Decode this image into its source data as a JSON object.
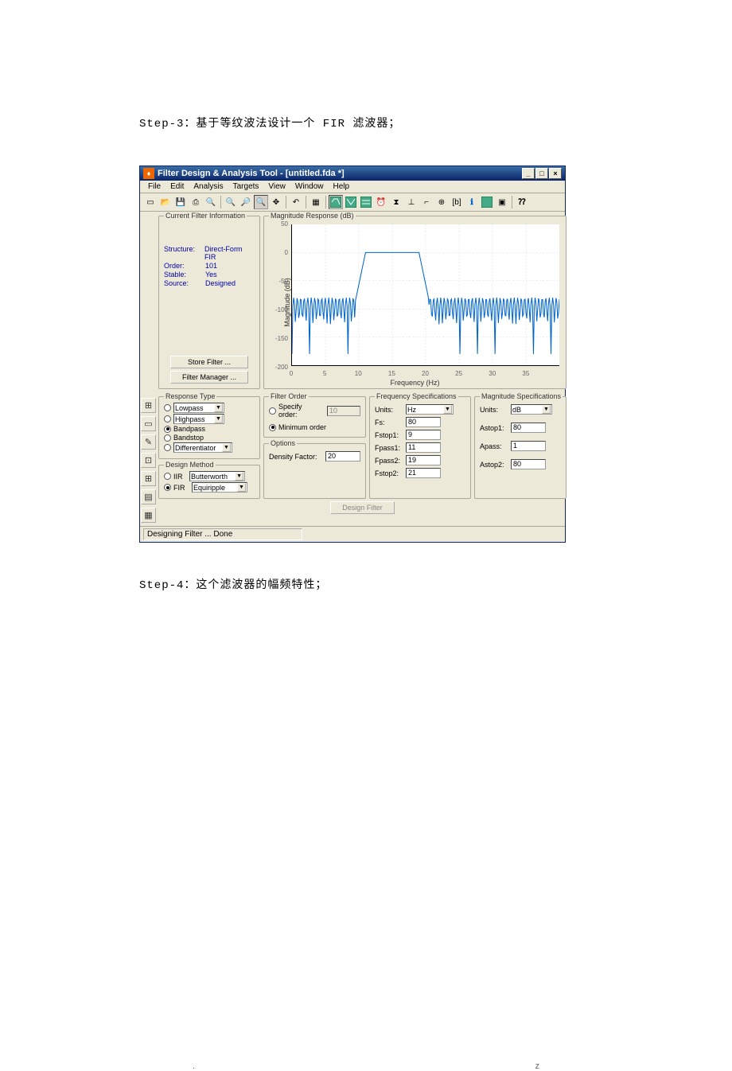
{
  "step3_text": "Step-3：基于等纹波法设计一个 FIR 滤波器；",
  "step4_text": "Step-4：这个滤波器的幅频特性；",
  "footer_left": ".",
  "footer_right": "z",
  "titlebar": "Filter Design & Analysis Tool - [untitled.fda *]",
  "menus": [
    "File",
    "Edit",
    "Analysis",
    "Targets",
    "View",
    "Window",
    "Help"
  ],
  "cfi": {
    "title": "Current Filter Information",
    "structure_k": "Structure:",
    "structure_v": "Direct-Form FIR",
    "order_k": "Order:",
    "order_v": "101",
    "stable_k": "Stable:",
    "stable_v": "Yes",
    "source_k": "Source:",
    "source_v": "Designed",
    "store_btn": "Store Filter ...",
    "manager_btn": "Filter Manager ..."
  },
  "mag": {
    "title": "Magnitude Response (dB)",
    "ylabel": "Magnitude (dB)",
    "xlabel": "Frequency (Hz)"
  },
  "rt": {
    "title": "Response Type",
    "lowpass": "Lowpass",
    "highpass": "Highpass",
    "bandpass": "Bandpass",
    "bandstop": "Bandstop",
    "diff": "Differentiator"
  },
  "dm": {
    "title": "Design Method",
    "iir_label": "IIR",
    "iir_val": "Butterworth",
    "fir_label": "FIR",
    "fir_val": "Equiripple"
  },
  "fo": {
    "title": "Filter Order",
    "specify": "Specify order:",
    "specify_val": "10",
    "minimum": "Minimum order"
  },
  "opt": {
    "title": "Options",
    "density": "Density Factor:",
    "density_val": "20"
  },
  "fs": {
    "title": "Frequency Specifications",
    "units": "Units:",
    "units_val": "Hz",
    "fs_label": "Fs:",
    "fs_val": "80",
    "fstop1": "Fstop1:",
    "fstop1_val": "9",
    "fpass1": "Fpass1:",
    "fpass1_val": "11",
    "fpass2": "Fpass2:",
    "fpass2_val": "19",
    "fstop2": "Fstop2:",
    "fstop2_val": "21"
  },
  "ms": {
    "title": "Magnitude Specifications",
    "units": "Units:",
    "units_val": "dB",
    "astop1": "Astop1:",
    "astop1_val": "80",
    "apass": "Apass:",
    "apass_val": "1",
    "astop2": "Astop2:",
    "astop2_val": "80"
  },
  "design_btn": "Design Filter",
  "status": "Designing Filter ... Done",
  "chart_data": {
    "type": "line",
    "title": "Magnitude Response (dB)",
    "xlabel": "Frequency (Hz)",
    "ylabel": "Magnitude (dB)",
    "ylim": [
      -200,
      50
    ],
    "xlim": [
      0,
      40
    ],
    "yticks": [
      -200,
      -150,
      -100,
      -50,
      0,
      50
    ],
    "xticks": [
      0,
      5,
      10,
      15,
      20,
      25,
      30,
      35
    ],
    "series": [
      {
        "name": "Magnitude",
        "x": [
          0,
          1,
          2,
          3,
          4,
          5,
          6,
          7,
          8,
          9,
          10,
          11,
          12,
          13,
          14,
          15,
          16,
          17,
          18,
          19,
          20,
          21,
          22,
          23,
          24,
          25,
          26,
          27,
          28,
          29,
          30,
          31,
          32,
          33,
          34,
          35,
          36,
          37,
          38,
          39,
          40
        ],
        "y": [
          -85,
          -82,
          -88,
          -84,
          -86,
          -83,
          -87,
          -82,
          -85,
          -80,
          -40,
          0,
          0,
          0,
          0,
          0,
          0,
          0,
          0,
          0,
          -40,
          -80,
          -84,
          -82,
          -86,
          -83,
          -87,
          -82,
          -85,
          -83,
          -86,
          -82,
          -87,
          -83,
          -85,
          -82,
          -86,
          -83,
          -87,
          -82,
          -85
        ]
      }
    ]
  }
}
